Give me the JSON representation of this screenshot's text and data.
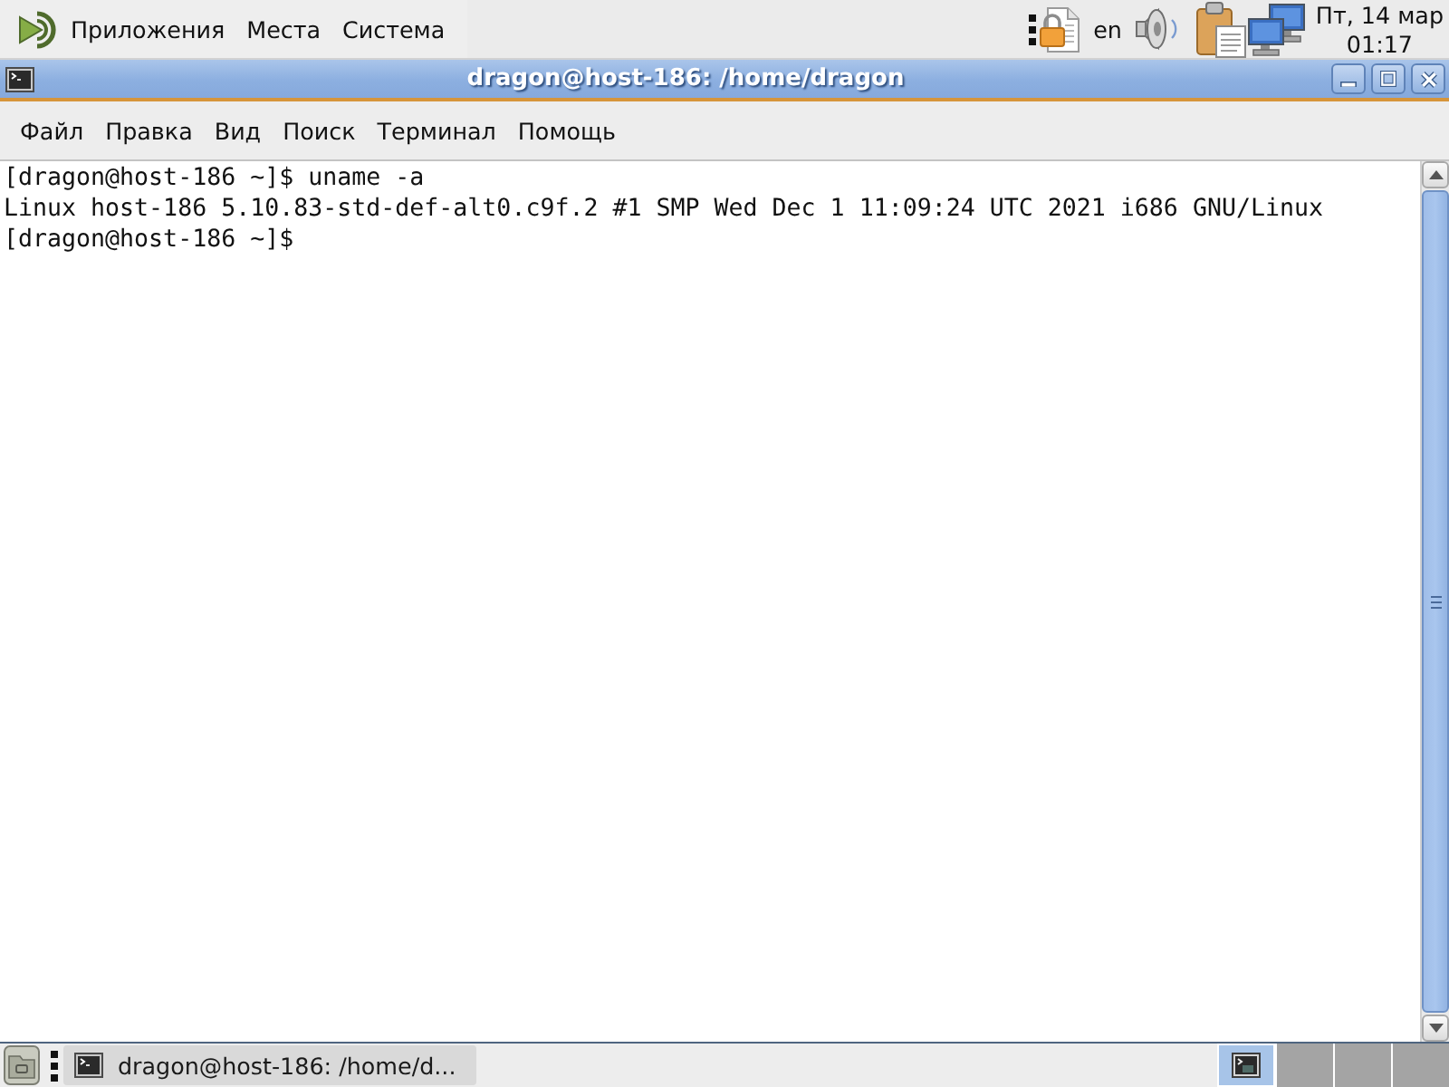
{
  "top_panel": {
    "menus": [
      "Приложения",
      "Места",
      "Система"
    ],
    "keyboard_layout": "en",
    "clock": {
      "date": "Пт, 14 мар",
      "time": "01:17"
    }
  },
  "window": {
    "title": "dragon@host-186: /home/dragon",
    "menu": [
      "Файл",
      "Правка",
      "Вид",
      "Поиск",
      "Терминал",
      "Помощь"
    ]
  },
  "terminal": {
    "lines": [
      "[dragon@host-186 ~]$ uname -a",
      "Linux host-186 5.10.83-std-def-alt0.c9f.2 #1 SMP Wed Dec 1 11:09:24 UTC 2021 i686 GNU/Linux",
      "[dragon@host-186 ~]$"
    ]
  },
  "bottom_panel": {
    "tasks": [
      {
        "label": "dragon@host-186: /home/d...",
        "selected": true
      }
    ],
    "workspaces": [
      {
        "selected": true,
        "has_window": true
      },
      {
        "selected": false,
        "has_window": false
      },
      {
        "selected": false,
        "has_window": false
      },
      {
        "selected": false,
        "has_window": false
      }
    ]
  }
}
